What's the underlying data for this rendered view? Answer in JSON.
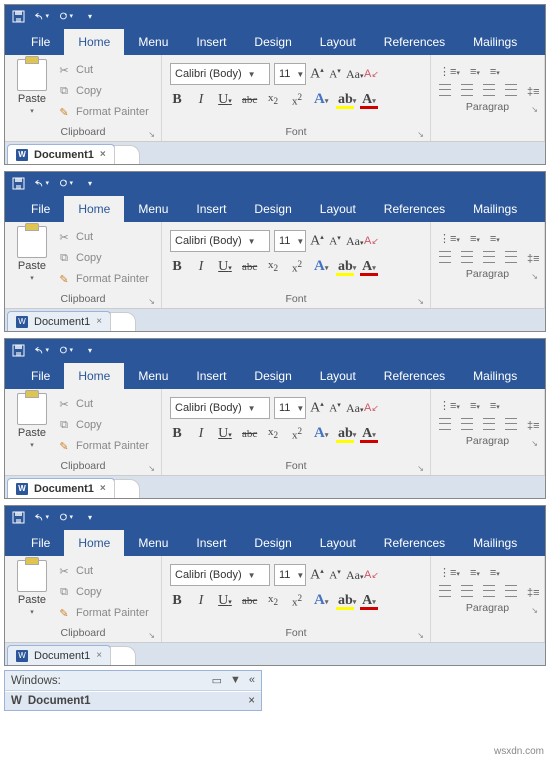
{
  "quick_access": {
    "save": "save-icon",
    "undo": "undo-icon",
    "redo": "redo-icon",
    "customize": "▾"
  },
  "tabs": {
    "file": "File",
    "home": "Home",
    "menu": "Menu",
    "insert": "Insert",
    "design": "Design",
    "layout": "Layout",
    "references": "References",
    "mailings": "Mailings",
    "active": "home"
  },
  "clipboard": {
    "paste": "Paste",
    "cut": "Cut",
    "copy": "Copy",
    "format_painter": "Format Painter",
    "group_label": "Clipboard"
  },
  "font": {
    "name": "Calibri (Body)",
    "size": "11",
    "grow": "A▴",
    "shrink": "A▾",
    "case": "Aa",
    "clear": "clear",
    "bold": "B",
    "italic": "I",
    "underline": "U",
    "strike": "abc",
    "sub": "x₂",
    "sup": "x²",
    "effects": "A",
    "highlight": "A",
    "color": "A",
    "group_label": "Font"
  },
  "paragraph": {
    "group_label": "Paragrap"
  },
  "doc_tab": {
    "name": "Document1"
  },
  "windows_panel": {
    "title": "Windows:",
    "doc": "Document1"
  },
  "watermark": "wsxdn.com"
}
